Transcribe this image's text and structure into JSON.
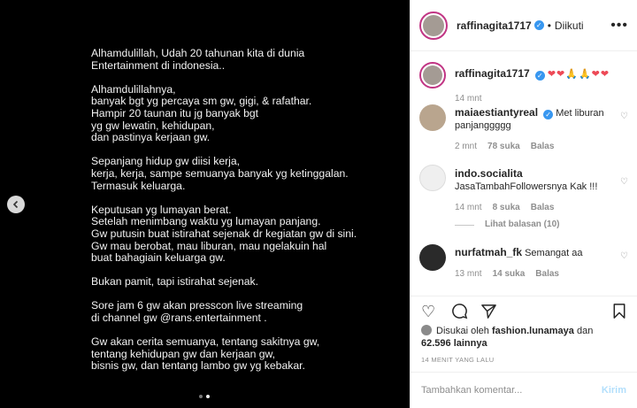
{
  "post": {
    "paragraphs": [
      "Alhamdulillah, Udah 20 tahunan kita  di dunia\nEntertainment di indonesia..",
      "Alhamdulillahnya,\nbanyak bgt yg percaya sm gw, gigi, & rafathar.\nHampir 20 taunan itu jg banyak bgt\nyg gw lewatin, kehidupan,\ndan pastinya  kerjaan gw.",
      "Sepanjang hidup gw diisi kerja,\nkerja, kerja, sampe semuanya banyak yg ketinggalan.\nTermasuk keluarga.",
      "Keputusan yg lumayan berat.\nSetelah menimbang waktu yg lumayan panjang.\nGw putusin buat istirahat sejenak dr kegiatan gw di sini.\nGw mau berobat, mau liburan, mau ngelakuin hal\nbuat bahagiain keluarga gw.",
      "Bukan pamit, tapi istirahat sejenak.",
      "Sore jam 6 gw akan presscon live streaming\ndi channel gw @rans.entertainment .",
      "Gw akan cerita semuanya, tentang sakitnya gw,\ntentang kehidupan gw dan kerjaan gw,\nbisnis gw, dan tentang lambo gw yg kebakar."
    ]
  },
  "header": {
    "username": "raffinagita1717",
    "separator": "•",
    "follow_status": "Diikuti"
  },
  "caption": {
    "username": "raffinagita1717",
    "text": "❤❤🙏🙏❤❤",
    "time": "14 mnt"
  },
  "comments": [
    {
      "username": "maiaestiantyreal",
      "text": "Met liburan panjanggggg",
      "time": "2 mnt",
      "likes": "78 suka",
      "reply": "Balas"
    },
    {
      "username": "indo.socialita",
      "text": "JasaTambahFollowersnya Kak !!!",
      "time": "14 mnt",
      "likes": "8 suka",
      "reply": "Balas",
      "view_replies": "Lihat balasan (10)"
    },
    {
      "username": "nurfatmah_fk",
      "text": "Semangat aa",
      "time": "13 mnt",
      "likes": "14 suka",
      "reply": "Balas"
    }
  ],
  "likes": {
    "prefix": "Disukai oleh",
    "user": "fashion.lunamaya",
    "connector": "dan",
    "count": "62.596 lainnya"
  },
  "timestamp": "14 MENIT YANG LALU",
  "comment_box": {
    "placeholder": "Tambahkan komentar...",
    "post_label": "Kirim"
  },
  "colors": {
    "verified": "#3897f0",
    "heart": "#ed4956",
    "story_ring": "#c13584"
  }
}
